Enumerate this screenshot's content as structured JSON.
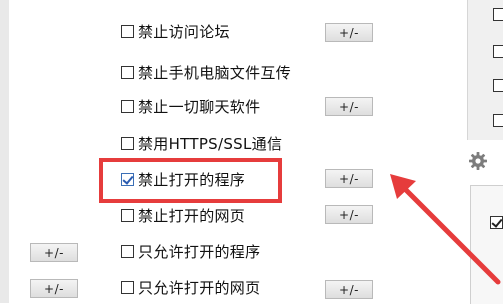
{
  "options": [
    {
      "label": "禁止访问论坛",
      "checked": false
    },
    {
      "label": "禁止手机电脑文件互传",
      "checked": false
    },
    {
      "label": "禁止一切聊天软件",
      "checked": false
    },
    {
      "label": "禁用HTTPS/SSL通信",
      "checked": false
    },
    {
      "label": "禁止打开的程序",
      "checked": true
    },
    {
      "label": "禁止打开的网页",
      "checked": false
    },
    {
      "label": "只允许打开的程序",
      "checked": false
    },
    {
      "label": "只允许打开的网页",
      "checked": false
    }
  ],
  "buttons": {
    "plus_minus": "+/-"
  },
  "colors": {
    "highlight": "#e63c3c",
    "arrow": "#e63c3c",
    "checkmark": "#2a5bb0"
  },
  "icons": {
    "gear": "gear-icon",
    "arrow": "annotation-arrow"
  }
}
